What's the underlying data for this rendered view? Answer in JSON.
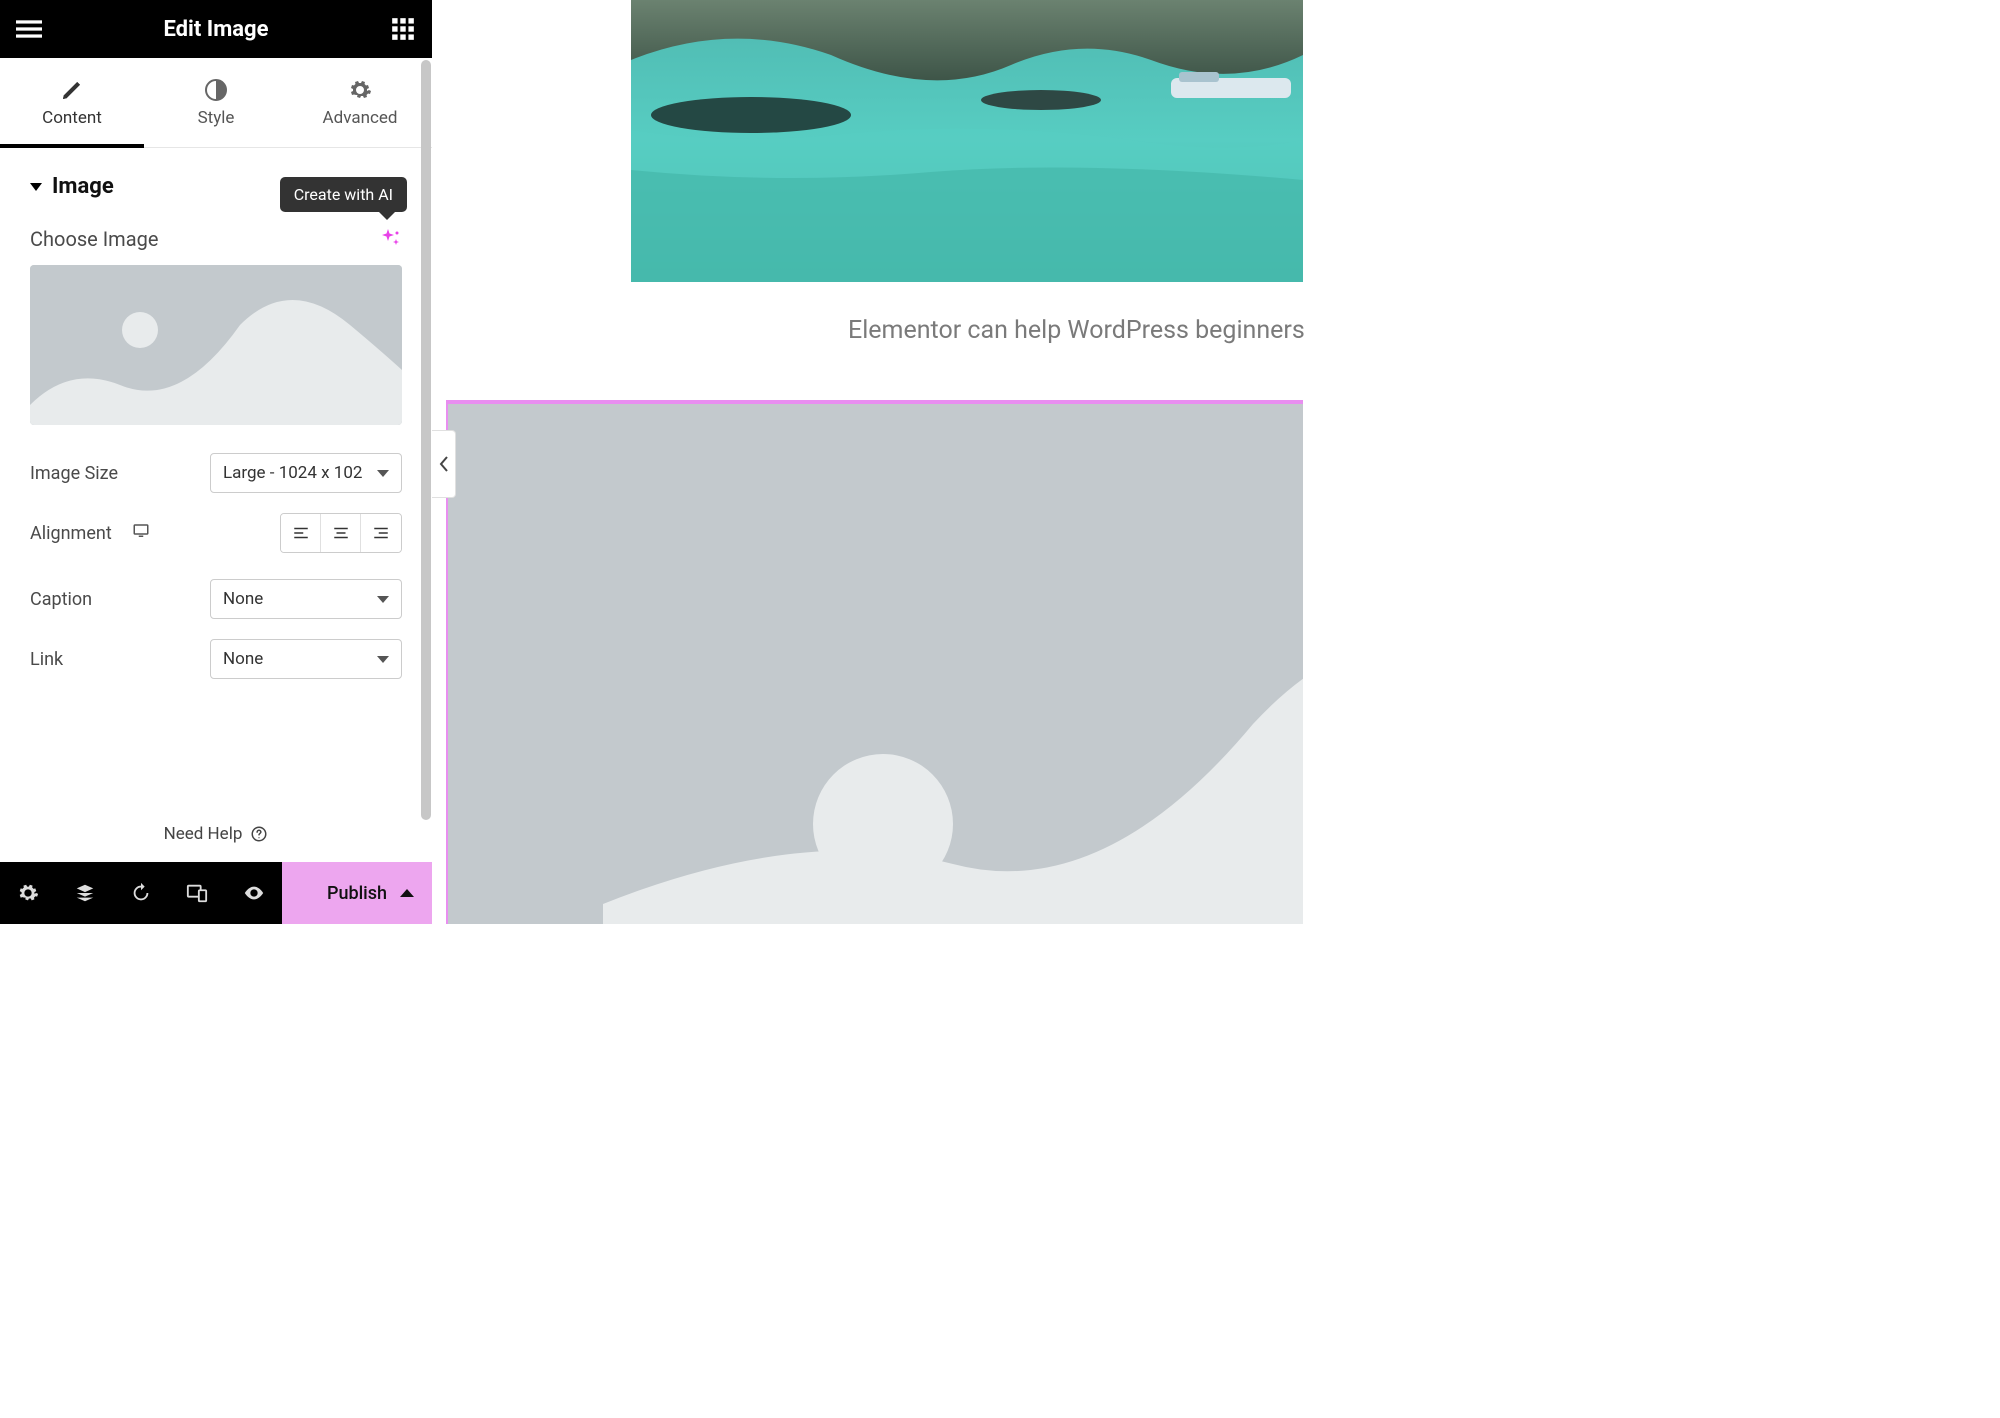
{
  "header": {
    "title": "Edit Image"
  },
  "tabs": {
    "content": "Content",
    "style": "Style",
    "advanced": "Advanced"
  },
  "section": {
    "title": "Image"
  },
  "fields": {
    "choose_image_label": "Choose Image",
    "ai_tooltip": "Create with AI",
    "image_size_label": "Image Size",
    "image_size_value": "Large - 1024 x 102",
    "alignment_label": "Alignment",
    "caption_label": "Caption",
    "caption_value": "None",
    "link_label": "Link",
    "link_value": "None"
  },
  "help": {
    "label": "Need Help"
  },
  "footer": {
    "publish": "Publish"
  },
  "canvas": {
    "caption": "Elementor can help WordPress beginners"
  },
  "colors": {
    "accent": "#eda6ef",
    "ai": "#e841e8",
    "selection": "#e88ef0"
  }
}
